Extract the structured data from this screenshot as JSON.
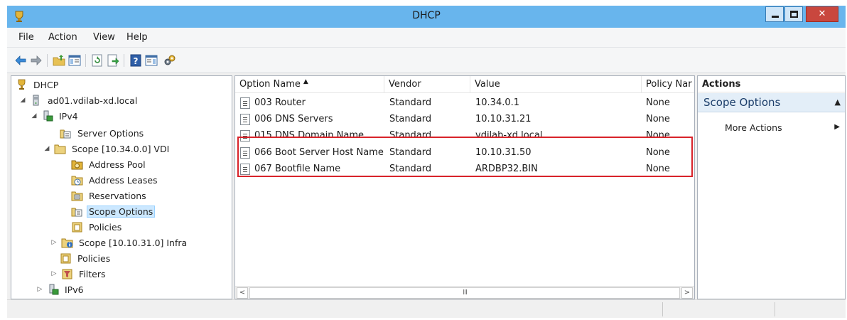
{
  "window": {
    "title": "DHCP"
  },
  "menu": [
    "File",
    "Action",
    "View",
    "Help"
  ],
  "toolbar": [
    "back-icon",
    "forward-icon",
    "up-folder-icon",
    "show-hide-tree-icon",
    "refresh-icon",
    "export-list-icon",
    "help-icon",
    "show-hide-action-pane-icon",
    "dhcp-tools-icon"
  ],
  "tree": {
    "root": "DHCP",
    "server": "ad01.vdilab-xd.local",
    "ipv4": "IPv4",
    "server_options": "Server Options",
    "scope1": "Scope [10.34.0.0] VDI",
    "address_pool": "Address Pool",
    "address_leases": "Address Leases",
    "reservations": "Reservations",
    "scope_options": "Scope Options",
    "scope_policies": "Policies",
    "scope2": "Scope [10.10.31.0] Infra",
    "policies": "Policies",
    "filters": "Filters",
    "ipv6": "IPv6"
  },
  "list": {
    "columns": [
      "Option Name",
      "Vendor",
      "Value",
      "Policy Nar"
    ],
    "sort_indicator": "▲",
    "rows": [
      {
        "name": "003 Router",
        "vendor": "Standard",
        "value": "10.34.0.1",
        "policy": "None"
      },
      {
        "name": "006 DNS Servers",
        "vendor": "Standard",
        "value": "10.10.31.21",
        "policy": "None"
      },
      {
        "name": "015 DNS Domain Name",
        "vendor": "Standard",
        "value": "vdilab-xd.local",
        "policy": "None"
      },
      {
        "name": "066 Boot Server Host Name",
        "vendor": "Standard",
        "value": "10.10.31.50",
        "policy": "None"
      },
      {
        "name": "067 Bootfile Name",
        "vendor": "Standard",
        "value": "ARDBP32.BIN",
        "policy": "None"
      }
    ],
    "scroll_left": "<",
    "scroll_thumb": "III",
    "scroll_right": ">"
  },
  "actions": {
    "header": "Actions",
    "group": "Scope Options",
    "more": "More Actions"
  },
  "colors": {
    "titlebar": "#68b5ed",
    "close": "#c9473e",
    "highlight_border": "#d8232a",
    "selection": "#cce8ff"
  }
}
